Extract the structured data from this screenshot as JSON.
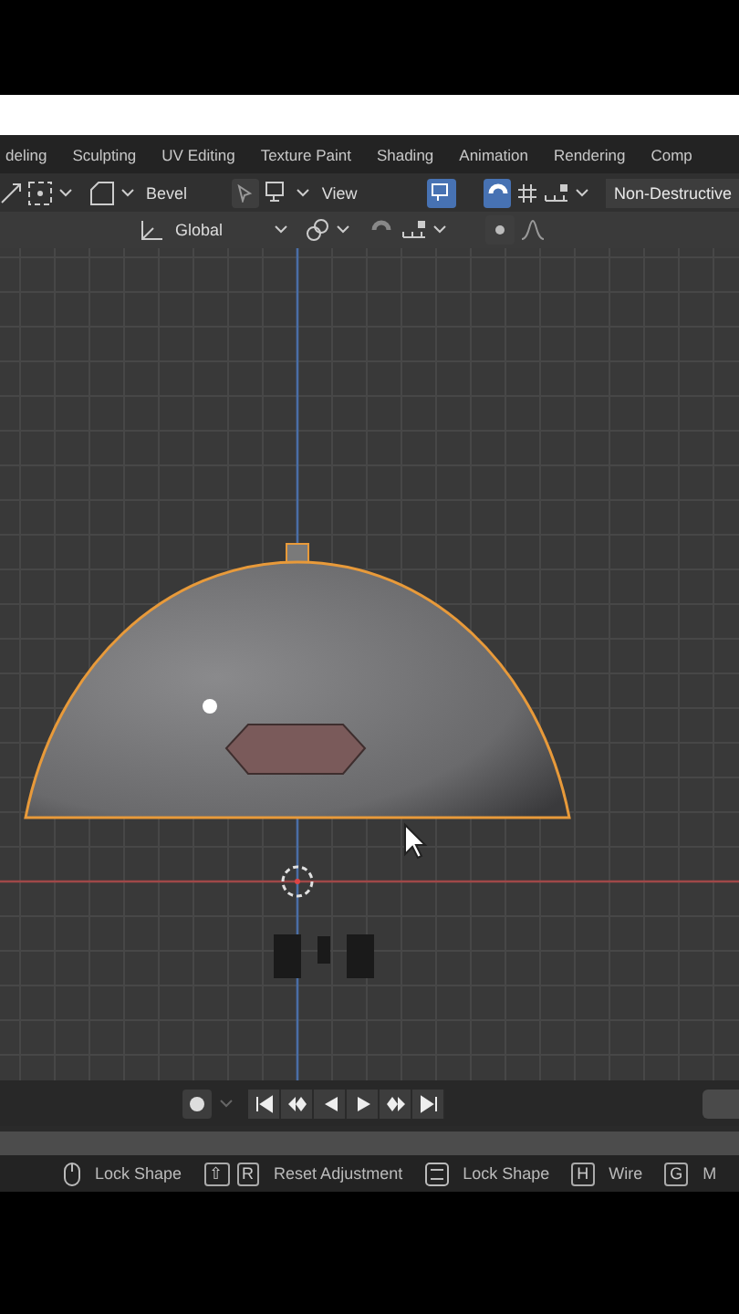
{
  "workspace_tabs": [
    {
      "label": "deling"
    },
    {
      "label": "Sculpting"
    },
    {
      "label": "UV Editing"
    },
    {
      "label": "Texture Paint"
    },
    {
      "label": "Shading"
    },
    {
      "label": "Animation"
    },
    {
      "label": "Rendering"
    },
    {
      "label": "Comp"
    }
  ],
  "tool_header": {
    "operator": "Bevel",
    "view_menu": "View",
    "overlay_on": true,
    "snap_on": true,
    "mode": "Non-Destructive"
  },
  "transform_header": {
    "orientation": "Global",
    "proportional_on": false
  },
  "status_bar": [
    {
      "kind": "mouse",
      "label": "Lock Shape"
    },
    {
      "kind": "keys",
      "keys": [
        "⇧",
        "R"
      ],
      "label": "Reset Adjustment"
    },
    {
      "kind": "tab",
      "label": "Lock Shape"
    },
    {
      "kind": "keys",
      "keys": [
        "H"
      ],
      "label": "Wire"
    },
    {
      "kind": "keys",
      "keys": [
        "G"
      ],
      "label": "M"
    }
  ]
}
